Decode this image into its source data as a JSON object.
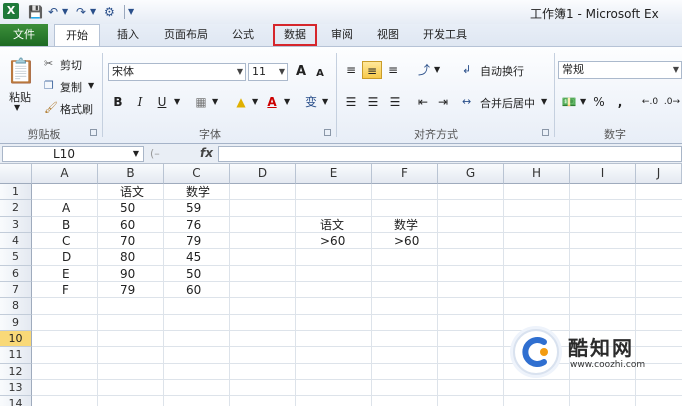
{
  "window": {
    "title": "工作簿1 - Microsoft Ex"
  },
  "quick_access": {
    "app_icon": "X",
    "save_icon": "save-icon",
    "undo_icon": "undo-icon",
    "redo_icon": "redo-icon",
    "customize_icon": "customize-icon"
  },
  "tabs": [
    {
      "label": "文件"
    },
    {
      "label": "开始"
    },
    {
      "label": "插入"
    },
    {
      "label": "页面布局"
    },
    {
      "label": "公式"
    },
    {
      "label": "数据"
    },
    {
      "label": "审阅"
    },
    {
      "label": "视图"
    },
    {
      "label": "开发工具"
    }
  ],
  "highlight_color": "#d6262c",
  "ribbon": {
    "clipboard": {
      "paste": "粘贴",
      "cut": "剪切",
      "copy": "复制",
      "format_painter": "格式刷",
      "label": "剪贴板"
    },
    "font": {
      "font_name": "宋体",
      "font_size": "11",
      "grow": "A",
      "shrink": "A",
      "bold": "B",
      "italic": "I",
      "underline": "U",
      "font_color": "A",
      "phonetic": "变",
      "label": "字体"
    },
    "alignment": {
      "wrap": "自动换行",
      "merge": "合并后居中",
      "label": "对齐方式"
    },
    "number": {
      "format": "常规",
      "percent": "%",
      "comma": ",",
      "label": "数字"
    }
  },
  "formula_bar": {
    "name_box": "L10",
    "fx": "fx",
    "content": ""
  },
  "columns": [
    "A",
    "B",
    "C",
    "D",
    "E",
    "F",
    "G",
    "H",
    "I",
    "J"
  ],
  "rows": [
    "1",
    "2",
    "3",
    "4",
    "5",
    "6",
    "7",
    "8",
    "9",
    "10",
    "11",
    "12",
    "13",
    "14"
  ],
  "selected_row": "10",
  "cells": {
    "B1": "语文",
    "C1": "数学",
    "A2": "A",
    "B2": "50",
    "C2": "59",
    "A3": "B",
    "B3": "60",
    "C3": "76",
    "A4": "C",
    "B4": "70",
    "C4": "79",
    "A5": "D",
    "B5": "80",
    "C5": "45",
    "A6": "E",
    "B6": "90",
    "C6": "50",
    "A7": "F",
    "B7": "79",
    "C7": "60",
    "E3": "语文",
    "F3": "数学",
    "E4": ">60",
    "F4": ">60"
  },
  "watermark": {
    "name": "酷知网",
    "url": "www.coozhi.com"
  }
}
